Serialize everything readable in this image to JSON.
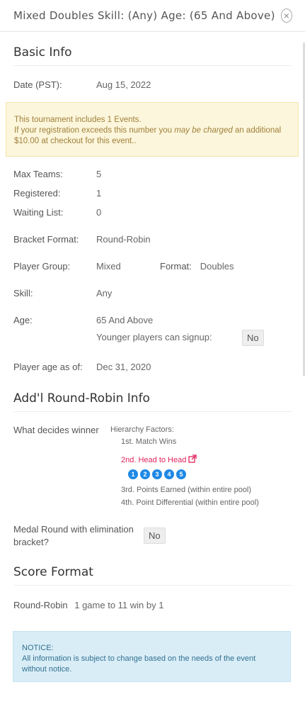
{
  "header": {
    "title": "Mixed Doubles Skill: (Any) Age: (65 And Above)",
    "close_icon": "×"
  },
  "basic": {
    "heading": "Basic Info",
    "date_label": "Date (PST):",
    "date_value": "Aug 15, 2022",
    "warning_line1": "This tournament includes 1 Events.",
    "warning_line2a": "If your registration exceeds this number you ",
    "warning_em": "may be charged",
    "warning_line2b": " an additional $10.00 at checkout for this event..",
    "max_label": "Max Teams:",
    "max_value": "5",
    "reg_label": "Registered:",
    "reg_value": "1",
    "wait_label": "Waiting List:",
    "wait_value": "0",
    "bracket_label": "Bracket Format:",
    "bracket_value": "Round-Robin",
    "group_label": "Player Group:",
    "group_value": "Mixed",
    "format_label": "Format:",
    "format_value": "Doubles",
    "skill_label": "Skill:",
    "skill_value": "Any",
    "age_label": "Age:",
    "age_value": "65 And Above",
    "younger_label": "Younger players can signup:",
    "younger_value": "No",
    "age_asof_label": "Player age as of:",
    "age_asof_value": "Dec 31, 2020"
  },
  "rr": {
    "heading": "Add'l Round-Robin Info",
    "winner_label": "What decides winner",
    "factors_label": "Hierarchy Factors:",
    "f1": "1st. Match Wins",
    "f2": "2nd. Head to Head",
    "pills": [
      "1",
      "2",
      "3",
      "4",
      "5"
    ],
    "f3": "3rd. Points Earned (within entire pool)",
    "f4": "4th. Point Differential (within entire pool)",
    "medal_label": "Medal Round with elimination bracket?",
    "medal_value": "No"
  },
  "score": {
    "heading": "Score Format",
    "label": "Round-Robin",
    "value": "1 game to 11 win by 1"
  },
  "notice": {
    "title": "NOTICE:",
    "text": "All information is subject to change based on the needs of the event without notice."
  },
  "colors": {
    "link": "#e0245e",
    "pill": "#1e88e5",
    "warning_bg": "#fcf6dc",
    "notice_bg": "#d9edf7"
  }
}
